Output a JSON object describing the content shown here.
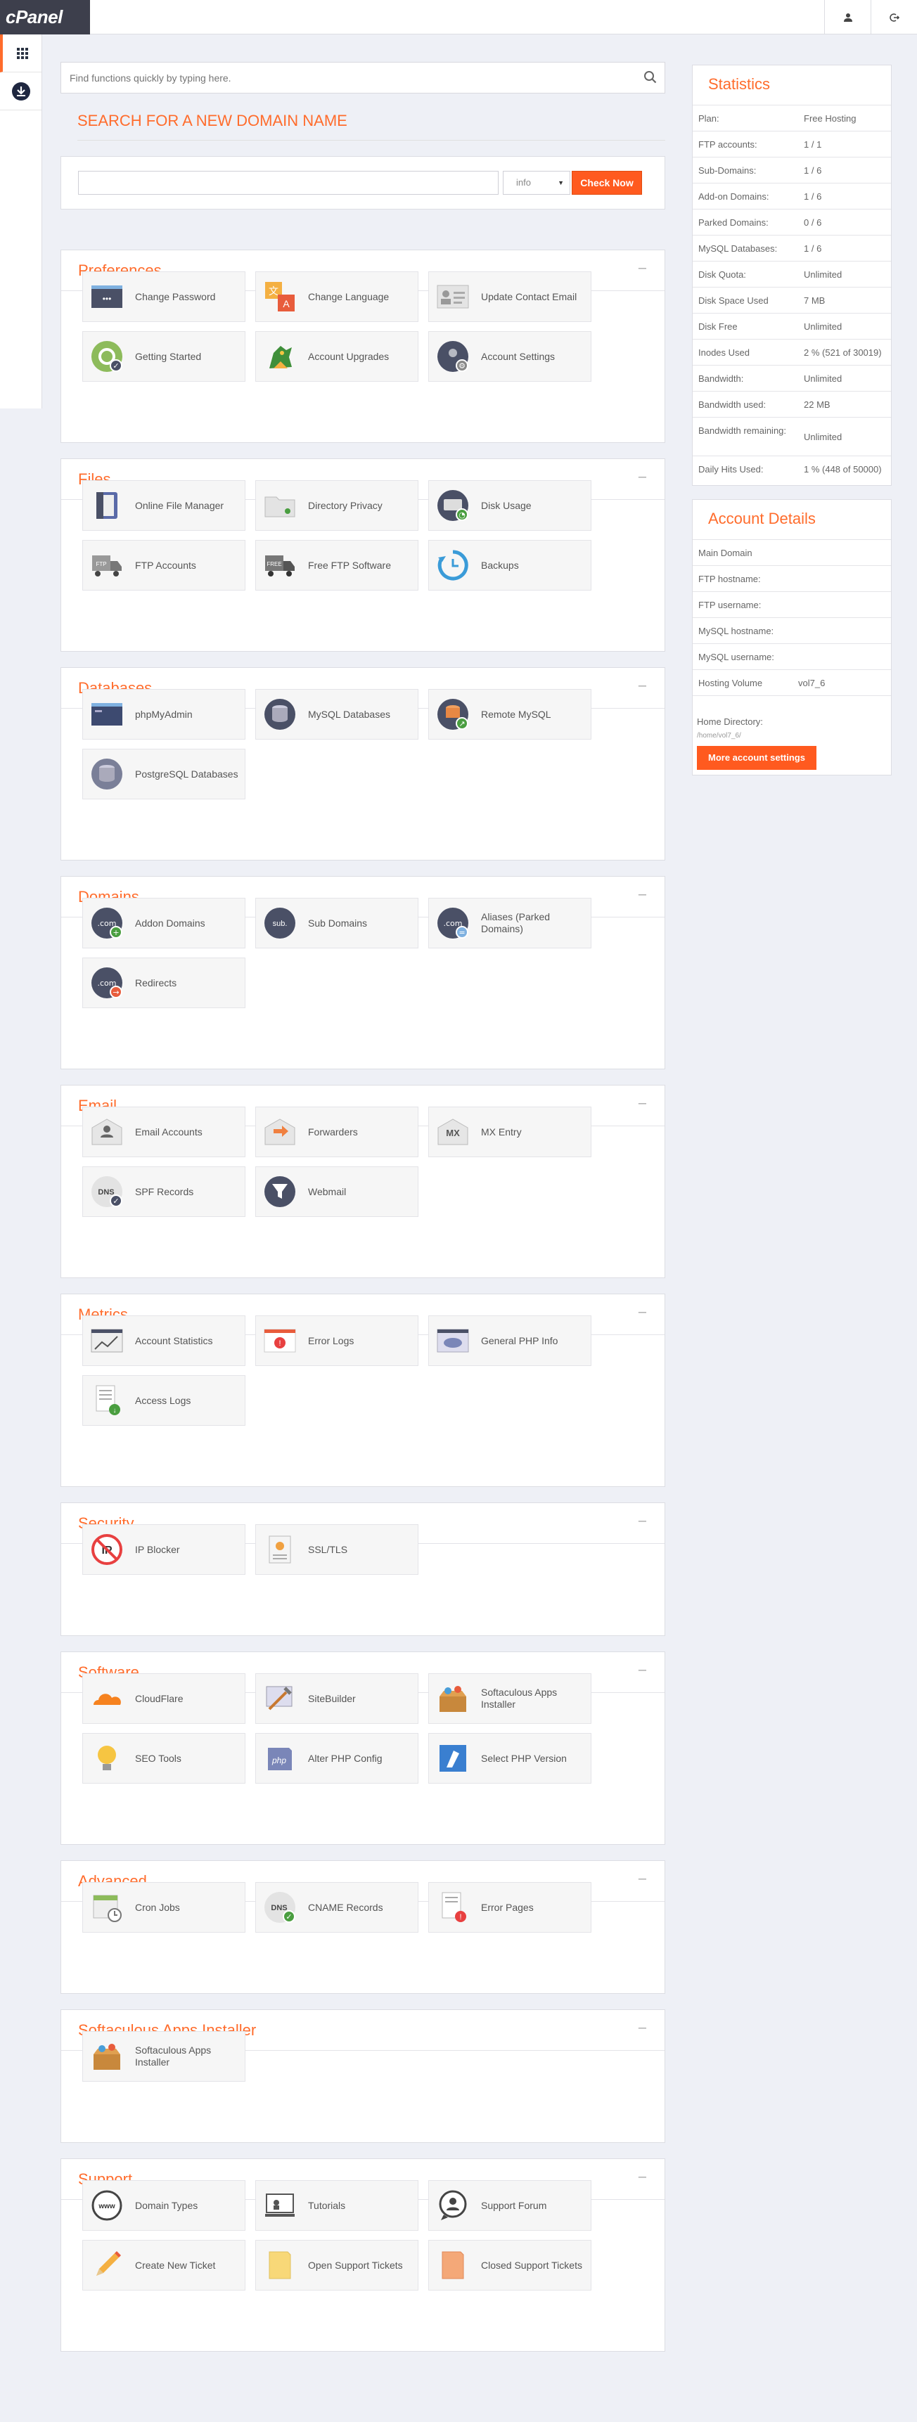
{
  "app": {
    "logo": "cPanel"
  },
  "search": {
    "placeholder": "Find functions quickly by typing here."
  },
  "domain": {
    "title": "SEARCH FOR A NEW DOMAIN NAME",
    "tld": "info",
    "check_label": "Check Now"
  },
  "sections": [
    {
      "title": "Preferences",
      "items": [
        {
          "label": "Change Password",
          "icon": "password-icon"
        },
        {
          "label": "Change Language",
          "icon": "language-icon"
        },
        {
          "label": "Update Contact Email",
          "icon": "contact-card-icon"
        },
        {
          "label": "Getting Started",
          "icon": "getting-started-icon"
        },
        {
          "label": "Account Upgrades",
          "icon": "upgrade-dragon-icon"
        },
        {
          "label": "Account Settings",
          "icon": "account-settings-icon"
        }
      ]
    },
    {
      "title": "Files",
      "items": [
        {
          "label": "Online File Manager",
          "icon": "file-manager-icon"
        },
        {
          "label": "Directory Privacy",
          "icon": "folder-lock-icon"
        },
        {
          "label": "Disk Usage",
          "icon": "disk-usage-icon"
        },
        {
          "label": "FTP Accounts",
          "icon": "ftp-truck-icon"
        },
        {
          "label": "Free FTP Software",
          "icon": "ftp-software-icon"
        },
        {
          "label": "Backups",
          "icon": "backup-icon"
        }
      ]
    },
    {
      "title": "Databases",
      "items": [
        {
          "label": "phpMyAdmin",
          "icon": "phpmyadmin-icon"
        },
        {
          "label": "MySQL Databases",
          "icon": "database-icon"
        },
        {
          "label": "Remote MySQL",
          "icon": "remote-database-icon"
        },
        {
          "label": "PostgreSQL Databases",
          "icon": "postgresql-icon"
        }
      ]
    },
    {
      "title": "Domains",
      "items": [
        {
          "label": "Addon Domains",
          "icon": "addon-domain-icon"
        },
        {
          "label": "Sub Domains",
          "icon": "subdomain-icon"
        },
        {
          "label": "Aliases (Parked Domains)",
          "icon": "alias-domain-icon"
        },
        {
          "label": "Redirects",
          "icon": "redirect-icon"
        }
      ]
    },
    {
      "title": "Email",
      "items": [
        {
          "label": "Email Accounts",
          "icon": "email-account-icon"
        },
        {
          "label": "Forwarders",
          "icon": "forwarder-icon"
        },
        {
          "label": "MX Entry",
          "icon": "mx-entry-icon"
        },
        {
          "label": "SPF Records",
          "icon": "spf-dns-icon"
        },
        {
          "label": "Webmail",
          "icon": "webmail-filter-icon"
        }
      ]
    },
    {
      "title": "Metrics",
      "items": [
        {
          "label": "Account Statistics",
          "icon": "statistics-icon"
        },
        {
          "label": "Error Logs",
          "icon": "error-log-icon"
        },
        {
          "label": "General PHP Info",
          "icon": "php-info-icon"
        },
        {
          "label": "Access Logs",
          "icon": "access-log-icon"
        }
      ]
    },
    {
      "title": "Security",
      "items": [
        {
          "label": "IP Blocker",
          "icon": "ip-blocker-icon"
        },
        {
          "label": "SSL/TLS",
          "icon": "ssl-certificate-icon"
        }
      ]
    },
    {
      "title": "Software",
      "items": [
        {
          "label": "CloudFlare",
          "icon": "cloudflare-icon"
        },
        {
          "label": "SiteBuilder",
          "icon": "sitebuilder-icon"
        },
        {
          "label": "Softaculous Apps Installer",
          "icon": "softaculous-icon"
        },
        {
          "label": "SEO Tools",
          "icon": "seo-bulb-icon"
        },
        {
          "label": "Alter PHP Config",
          "icon": "php-config-icon"
        },
        {
          "label": "Select PHP Version",
          "icon": "php-version-icon"
        }
      ]
    },
    {
      "title": "Advanced",
      "items": [
        {
          "label": "Cron Jobs",
          "icon": "cron-calendar-icon"
        },
        {
          "label": "CNAME Records",
          "icon": "cname-dns-icon"
        },
        {
          "label": "Error Pages",
          "icon": "error-page-icon"
        }
      ]
    },
    {
      "title": "Softaculous Apps Installer",
      "items": [
        {
          "label": "Softaculous Apps Installer",
          "icon": "softaculous-icon"
        }
      ]
    },
    {
      "title": "Support",
      "items": [
        {
          "label": "Domain Types",
          "icon": "www-icon"
        },
        {
          "label": "Tutorials",
          "icon": "tutorial-icon"
        },
        {
          "label": "Support Forum",
          "icon": "forum-icon"
        },
        {
          "label": "Create New Ticket",
          "icon": "pencil-icon"
        },
        {
          "label": "Open Support Tickets",
          "icon": "open-ticket-icon"
        },
        {
          "label": "Closed Support Tickets",
          "icon": "closed-ticket-icon"
        }
      ]
    }
  ],
  "statistics": {
    "title": "Statistics",
    "rows": [
      {
        "k": "Plan:",
        "v": "Free Hosting"
      },
      {
        "k": "FTP accounts:",
        "v": "1 / 1"
      },
      {
        "k": "Sub-Domains:",
        "v": "1 / 6"
      },
      {
        "k": "Add-on Domains:",
        "v": "1 / 6"
      },
      {
        "k": "Parked Domains:",
        "v": "0 / 6"
      },
      {
        "k": "MySQL Databases:",
        "v": "1 / 6"
      },
      {
        "k": "Disk Quota:",
        "v": "Unlimited"
      },
      {
        "k": "Disk Space Used",
        "v": "7 MB"
      },
      {
        "k": "Disk Free",
        "v": "Unlimited"
      },
      {
        "k": "Inodes Used",
        "v": "2 % (521 of 30019)"
      },
      {
        "k": "Bandwidth:",
        "v": "Unlimited"
      },
      {
        "k": "Bandwidth used:",
        "v": "22 MB"
      },
      {
        "k": "Bandwidth remaining:",
        "v": "Unlimited"
      },
      {
        "k": "Daily Hits Used:",
        "v": "1 % (448 of 50000)"
      }
    ]
  },
  "account": {
    "title": "Account Details",
    "rows": [
      {
        "k": "Main Domain",
        "v": ""
      },
      {
        "k": "FTP hostname:",
        "v": ""
      },
      {
        "k": "FTP username:",
        "v": ""
      },
      {
        "k": "MySQL hostname:",
        "v": ""
      },
      {
        "k": "MySQL username:",
        "v": ""
      },
      {
        "k": "Hosting Volume",
        "v": "vol7_6"
      }
    ],
    "home_label": "Home Directory:",
    "home_value": "/home/vol7_6/",
    "more_label": "More account settings"
  },
  "colors": {
    "accent": "#ff6c2c",
    "button": "#ff5a1f"
  }
}
